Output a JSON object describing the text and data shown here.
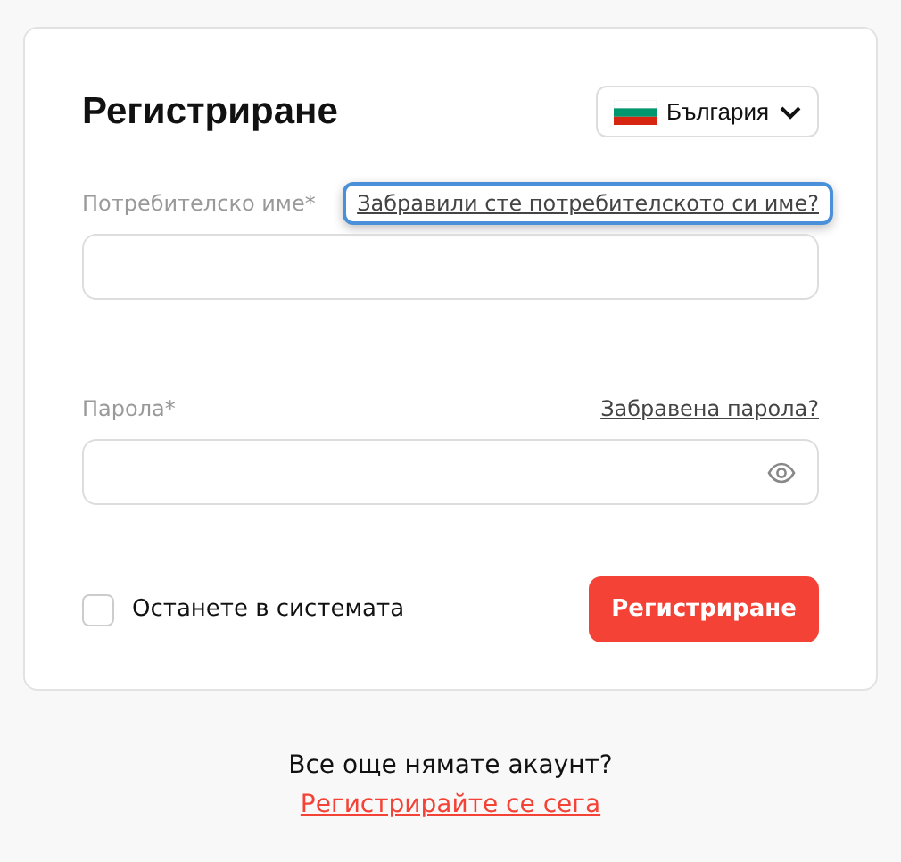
{
  "form": {
    "title": "Регистриране",
    "language": {
      "label": "България"
    },
    "fields": [
      {
        "kind": "text",
        "label": "Потребителско име*",
        "link": {
          "label": "Забравили сте потребителското си име?",
          "focused": true
        }
      },
      {
        "kind": "password",
        "label": "Парола*",
        "link": {
          "label": "Забравена парола?",
          "focused": false
        }
      }
    ],
    "remember": {
      "label": "Останете в системата",
      "checked": false
    },
    "submit": "Регистриране"
  },
  "footer": {
    "text": "Все още нямате акаунт?",
    "link": "Регистрирайте се сега"
  }
}
